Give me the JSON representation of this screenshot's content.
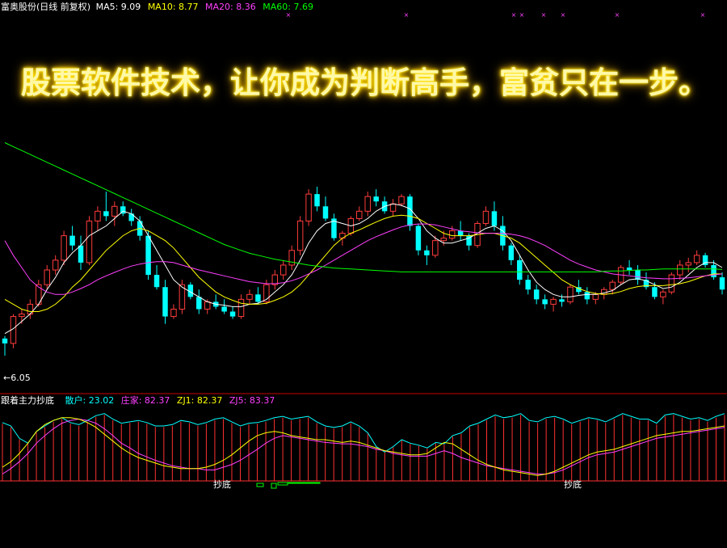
{
  "header": {
    "stock_label": "富奥股份(日线 前复权)",
    "ma5_label": "MA5: 9.09",
    "ma10_label": "MA10: 8.77",
    "ma20_label": "MA20: 8.36",
    "ma60_label": "MA60: 7.69"
  },
  "banner": {
    "text": "股票软件技术，让你成为判断高手，富贫只在一步。"
  },
  "low_marker": {
    "text": "←6.05"
  },
  "indicator": {
    "name": "跟着主力抄底",
    "sanhu_label": "散户: 23.02",
    "zhuangjia_label": "庄家: 82.37",
    "zj1_label": "ZJ1: 82.37",
    "zj5_label": "ZJ5: 83.37",
    "signal_label_1": "抄底",
    "signal_label_2": "抄底"
  },
  "colors": {
    "background": "#000000",
    "up": "#ff3c3c",
    "down": "#00ffff",
    "ma5": "#ffffff",
    "ma10": "#ffff00",
    "ma20": "#ff40ff",
    "ma60": "#00ff00",
    "divider": "#cc0000",
    "banner": "#ffff66"
  },
  "chart_data": {
    "type": "candlestick",
    "y_min_label": "6.05",
    "price_range": [
      6.05,
      9.6
    ],
    "ohlc": [
      [
        6.4,
        6.45,
        6.05,
        6.3
      ],
      [
        6.3,
        6.9,
        6.2,
        6.85
      ],
      [
        6.85,
        7.0,
        6.7,
        6.9
      ],
      [
        6.9,
        7.2,
        6.8,
        7.1
      ],
      [
        7.1,
        7.6,
        7.05,
        7.5
      ],
      [
        7.5,
        7.9,
        7.4,
        7.8
      ],
      [
        7.8,
        8.1,
        7.7,
        8.0
      ],
      [
        8.0,
        8.6,
        7.9,
        8.5
      ],
      [
        8.5,
        8.7,
        8.2,
        8.3
      ],
      [
        8.3,
        8.5,
        7.8,
        7.95
      ],
      [
        7.95,
        8.9,
        7.9,
        8.8
      ],
      [
        8.8,
        9.1,
        8.6,
        9.0
      ],
      [
        9.0,
        9.4,
        8.8,
        8.9
      ],
      [
        8.9,
        9.2,
        8.7,
        9.1
      ],
      [
        9.1,
        9.2,
        8.9,
        8.95
      ],
      [
        8.95,
        9.05,
        8.7,
        8.8
      ],
      [
        8.8,
        8.9,
        8.4,
        8.5
      ],
      [
        8.5,
        8.6,
        7.6,
        7.7
      ],
      [
        7.7,
        7.9,
        7.4,
        7.45
      ],
      [
        7.45,
        7.6,
        6.7,
        6.85
      ],
      [
        6.85,
        7.1,
        6.8,
        7.0
      ],
      [
        7.0,
        7.6,
        6.9,
        7.5
      ],
      [
        7.5,
        7.55,
        7.2,
        7.25
      ],
      [
        7.25,
        7.4,
        6.9,
        7.0
      ],
      [
        7.0,
        7.2,
        6.9,
        7.15
      ],
      [
        7.15,
        7.3,
        7.0,
        7.05
      ],
      [
        7.05,
        7.2,
        6.9,
        6.95
      ],
      [
        6.95,
        7.05,
        6.8,
        6.85
      ],
      [
        6.85,
        7.3,
        6.8,
        7.2
      ],
      [
        7.2,
        7.4,
        7.1,
        7.3
      ],
      [
        7.3,
        7.45,
        7.1,
        7.15
      ],
      [
        7.15,
        7.6,
        7.1,
        7.5
      ],
      [
        7.5,
        7.8,
        7.4,
        7.7
      ],
      [
        7.7,
        8.0,
        7.6,
        7.9
      ],
      [
        7.9,
        8.3,
        7.8,
        8.2
      ],
      [
        8.2,
        8.9,
        8.1,
        8.8
      ],
      [
        8.8,
        9.45,
        8.7,
        9.35
      ],
      [
        9.35,
        9.5,
        9.0,
        9.1
      ],
      [
        9.1,
        9.3,
        8.8,
        8.85
      ],
      [
        8.85,
        8.95,
        8.4,
        8.45
      ],
      [
        8.45,
        8.6,
        8.3,
        8.55
      ],
      [
        8.55,
        8.9,
        8.5,
        8.85
      ],
      [
        8.85,
        9.1,
        8.8,
        9.0
      ],
      [
        9.0,
        9.4,
        8.9,
        9.3
      ],
      [
        9.3,
        9.45,
        9.1,
        9.2
      ],
      [
        9.2,
        9.3,
        8.95,
        9.0
      ],
      [
        9.0,
        9.25,
        8.9,
        9.15
      ],
      [
        9.15,
        9.35,
        9.1,
        9.3
      ],
      [
        9.3,
        9.35,
        8.6,
        8.7
      ],
      [
        8.7,
        8.75,
        8.1,
        8.2
      ],
      [
        8.2,
        8.3,
        7.9,
        8.1
      ],
      [
        8.1,
        8.5,
        8.05,
        8.4
      ],
      [
        8.4,
        8.6,
        8.3,
        8.45
      ],
      [
        8.45,
        8.7,
        8.4,
        8.6
      ],
      [
        8.6,
        8.8,
        8.4,
        8.5
      ],
      [
        8.5,
        8.55,
        8.2,
        8.3
      ],
      [
        8.3,
        8.8,
        8.25,
        8.75
      ],
      [
        8.75,
        9.1,
        8.7,
        9.0
      ],
      [
        9.0,
        9.2,
        8.6,
        8.7
      ],
      [
        8.7,
        8.9,
        8.2,
        8.3
      ],
      [
        8.3,
        8.35,
        7.9,
        8.0
      ],
      [
        8.0,
        8.1,
        7.5,
        7.6
      ],
      [
        7.6,
        7.7,
        7.3,
        7.4
      ],
      [
        7.4,
        7.5,
        7.1,
        7.2
      ],
      [
        7.2,
        7.3,
        7.0,
        7.1
      ],
      [
        7.1,
        7.25,
        6.95,
        7.2
      ],
      [
        7.2,
        7.3,
        7.05,
        7.15
      ],
      [
        7.15,
        7.5,
        7.1,
        7.45
      ],
      [
        7.45,
        7.6,
        7.3,
        7.35
      ],
      [
        7.35,
        7.45,
        7.1,
        7.2
      ],
      [
        7.2,
        7.35,
        7.1,
        7.3
      ],
      [
        7.3,
        7.45,
        7.2,
        7.4
      ],
      [
        7.4,
        7.6,
        7.3,
        7.55
      ],
      [
        7.55,
        7.9,
        7.5,
        7.85
      ],
      [
        7.85,
        8.0,
        7.7,
        7.8
      ],
      [
        7.8,
        7.9,
        7.5,
        7.6
      ],
      [
        7.6,
        7.75,
        7.4,
        7.45
      ],
      [
        7.45,
        7.55,
        7.2,
        7.25
      ],
      [
        7.25,
        7.4,
        7.1,
        7.35
      ],
      [
        7.35,
        7.75,
        7.3,
        7.7
      ],
      [
        7.7,
        8.0,
        7.6,
        7.9
      ],
      [
        7.9,
        8.05,
        7.75,
        7.95
      ],
      [
        7.95,
        8.2,
        7.9,
        8.1
      ],
      [
        8.1,
        8.15,
        7.85,
        7.9
      ],
      [
        7.9,
        8.0,
        7.6,
        7.65
      ],
      [
        7.65,
        7.75,
        7.3,
        7.4
      ]
    ],
    "ma": {
      "MA5": [
        6.5,
        6.6,
        6.75,
        6.9,
        7.1,
        7.4,
        7.65,
        7.95,
        8.15,
        8.3,
        8.5,
        8.6,
        8.7,
        8.85,
        9.0,
        8.95,
        8.8,
        8.5,
        8.2,
        7.9,
        7.6,
        7.45,
        7.35,
        7.25,
        7.15,
        7.1,
        7.08,
        7.05,
        7.05,
        7.1,
        7.12,
        7.2,
        7.35,
        7.5,
        7.7,
        8.0,
        8.35,
        8.6,
        8.75,
        8.8,
        8.75,
        8.7,
        8.75,
        8.85,
        9.0,
        9.1,
        9.15,
        9.12,
        9.05,
        8.85,
        8.6,
        8.45,
        8.35,
        8.35,
        8.4,
        8.45,
        8.55,
        8.65,
        8.7,
        8.6,
        8.4,
        8.1,
        7.8,
        7.55,
        7.4,
        7.3,
        7.25,
        7.25,
        7.28,
        7.3,
        7.3,
        7.33,
        7.38,
        7.5,
        7.6,
        7.62,
        7.58,
        7.5,
        7.42,
        7.45,
        7.55,
        7.7,
        7.85,
        7.95,
        7.95,
        7.85
      ],
      "MA10": [
        7.2,
        7.1,
        7.0,
        6.95,
        6.95,
        7.0,
        7.1,
        7.25,
        7.45,
        7.6,
        7.8,
        8.0,
        8.2,
        8.35,
        8.5,
        8.6,
        8.65,
        8.6,
        8.5,
        8.4,
        8.25,
        8.05,
        7.85,
        7.65,
        7.5,
        7.35,
        7.25,
        7.18,
        7.12,
        7.1,
        7.1,
        7.12,
        7.18,
        7.25,
        7.35,
        7.5,
        7.7,
        7.9,
        8.1,
        8.3,
        8.45,
        8.55,
        8.62,
        8.7,
        8.78,
        8.85,
        8.9,
        8.92,
        8.9,
        8.85,
        8.75,
        8.65,
        8.55,
        8.5,
        8.5,
        8.5,
        8.52,
        8.55,
        8.55,
        8.5,
        8.45,
        8.35,
        8.2,
        8.05,
        7.9,
        7.75,
        7.6,
        7.5,
        7.42,
        7.36,
        7.32,
        7.3,
        7.32,
        7.36,
        7.42,
        7.46,
        7.48,
        7.48,
        7.48,
        7.5,
        7.52,
        7.56,
        7.62,
        7.68,
        7.72,
        7.72
      ],
      "MA20": [
        8.4,
        8.1,
        7.85,
        7.6,
        7.45,
        7.35,
        7.3,
        7.3,
        7.35,
        7.42,
        7.5,
        7.6,
        7.68,
        7.75,
        7.82,
        7.88,
        7.92,
        7.95,
        7.97,
        7.97,
        7.95,
        7.9,
        7.85,
        7.8,
        7.76,
        7.72,
        7.68,
        7.64,
        7.6,
        7.56,
        7.54,
        7.52,
        7.52,
        7.54,
        7.58,
        7.64,
        7.72,
        7.8,
        7.9,
        8.0,
        8.1,
        8.2,
        8.3,
        8.4,
        8.48,
        8.55,
        8.62,
        8.68,
        8.72,
        8.74,
        8.74,
        8.72,
        8.68,
        8.64,
        8.6,
        8.58,
        8.56,
        8.55,
        8.55,
        8.55,
        8.53,
        8.5,
        8.45,
        8.38,
        8.3,
        8.2,
        8.1,
        8.0,
        7.92,
        7.86,
        7.8,
        7.76,
        7.72,
        7.7,
        7.68,
        7.66,
        7.64,
        7.63,
        7.62,
        7.62,
        7.63,
        7.64,
        7.66,
        7.68,
        7.7,
        7.72
      ],
      "MA60": [
        10.4,
        10.32,
        10.24,
        10.16,
        10.08,
        10.0,
        9.92,
        9.84,
        9.76,
        9.68,
        9.6,
        9.52,
        9.44,
        9.36,
        9.28,
        9.2,
        9.12,
        9.04,
        8.96,
        8.88,
        8.8,
        8.72,
        8.64,
        8.56,
        8.48,
        8.4,
        8.32,
        8.26,
        8.2,
        8.14,
        8.1,
        8.06,
        8.02,
        7.99,
        7.96,
        7.93,
        7.9,
        7.88,
        7.86,
        7.84,
        7.83,
        7.82,
        7.81,
        7.8,
        7.79,
        7.78,
        7.77,
        7.76,
        7.76,
        7.76,
        7.76,
        7.76,
        7.76,
        7.76,
        7.76,
        7.76,
        7.76,
        7.76,
        7.76,
        7.76,
        7.76,
        7.76,
        7.76,
        7.76,
        7.76,
        7.76,
        7.76,
        7.76,
        7.76,
        7.76,
        7.76,
        7.77,
        7.78,
        7.78,
        7.79,
        7.8,
        7.8,
        7.81,
        7.82,
        7.82,
        7.82,
        7.82,
        7.82,
        7.82,
        7.82,
        7.81
      ]
    },
    "indicator": {
      "range": [
        0,
        100
      ],
      "sanhu": [
        85,
        80,
        62,
        55,
        72,
        80,
        88,
        92,
        85,
        82,
        88,
        95,
        98,
        90,
        84,
        86,
        88,
        85,
        80,
        80,
        82,
        88,
        86,
        82,
        85,
        90,
        92,
        86,
        80,
        84,
        85,
        88,
        92,
        94,
        90,
        92,
        94,
        86,
        80,
        78,
        80,
        86,
        80,
        70,
        50,
        42,
        50,
        60,
        55,
        52,
        48,
        56,
        54,
        66,
        70,
        80,
        84,
        90,
        96,
        92,
        94,
        98,
        88,
        86,
        92,
        94,
        90,
        84,
        88,
        92,
        90,
        86,
        92,
        98,
        94,
        90,
        90,
        84,
        96,
        98,
        94,
        90,
        92,
        88,
        94,
        98
      ],
      "zhuangjia": [
        10,
        18,
        28,
        40,
        55,
        66,
        76,
        84,
        88,
        90,
        88,
        84,
        76,
        66,
        55,
        48,
        40,
        35,
        30,
        26,
        22,
        20,
        18,
        18,
        16,
        16,
        20,
        24,
        30,
        38,
        46,
        55,
        62,
        66,
        64,
        62,
        60,
        58,
        56,
        55,
        54,
        54,
        52,
        50,
        46,
        44,
        40,
        38,
        36,
        36,
        36,
        40,
        44,
        40,
        34,
        30,
        26,
        22,
        20,
        18,
        16,
        14,
        12,
        10,
        10,
        12,
        16,
        22,
        28,
        34,
        38,
        40,
        42,
        46,
        50,
        54,
        58,
        62,
        64,
        66,
        68,
        70,
        72,
        74,
        76,
        78
      ],
      "zj1": [
        20,
        28,
        40,
        55,
        72,
        82,
        88,
        92,
        92,
        90,
        85,
        78,
        68,
        58,
        48,
        40,
        34,
        30,
        26,
        22,
        20,
        18,
        18,
        18,
        20,
        24,
        30,
        38,
        48,
        58,
        66,
        70,
        72,
        70,
        66,
        64,
        62,
        60,
        60,
        58,
        56,
        58,
        56,
        52,
        48,
        44,
        42,
        40,
        38,
        38,
        40,
        48,
        56,
        54,
        46,
        38,
        30,
        24,
        20,
        16,
        14,
        12,
        10,
        8,
        10,
        14,
        20,
        26,
        32,
        38,
        42,
        44,
        46,
        50,
        54,
        58,
        62,
        66,
        68,
        70,
        72,
        72,
        74,
        76,
        78,
        80
      ]
    },
    "signals": {
      "buy_markers": [
        "抄底",
        "抄底"
      ]
    }
  }
}
